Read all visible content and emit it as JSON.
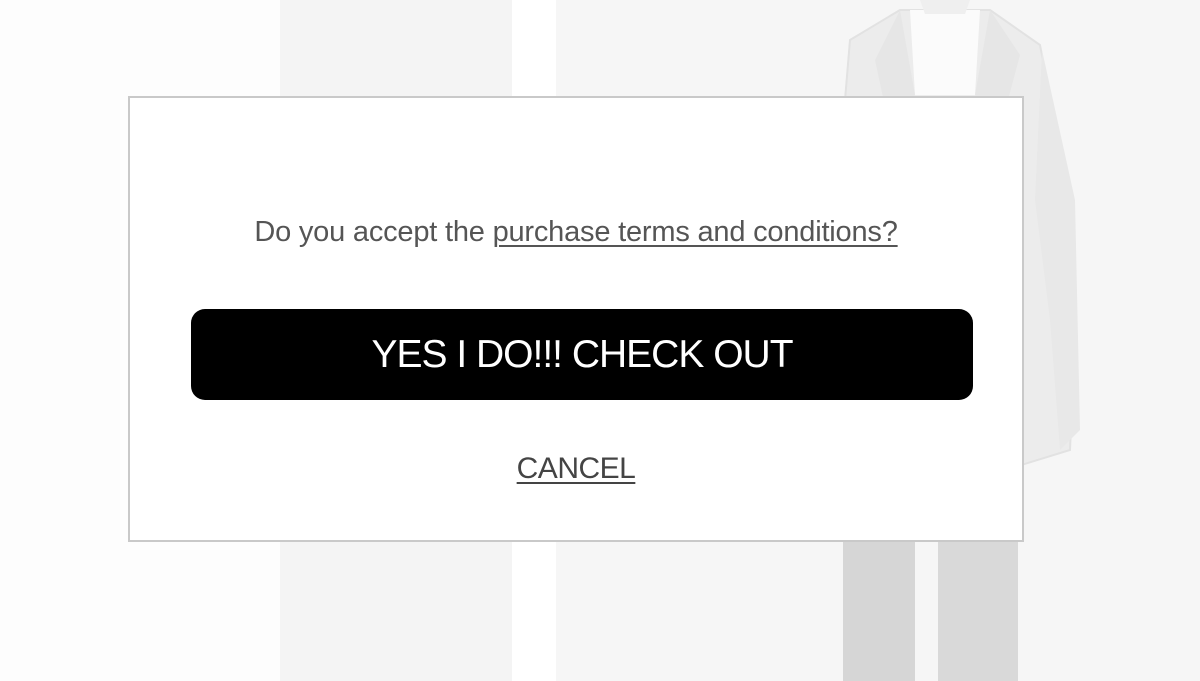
{
  "dialog": {
    "prompt_prefix": "Do you accept the ",
    "terms_link": "purchase terms and conditions?",
    "confirm_label": "YES I DO!!! CHECK OUT",
    "cancel_label": "CANCEL"
  },
  "colors": {
    "button_bg": "#000000",
    "button_text": "#ffffff",
    "text": "#555555",
    "modal_border": "#c9c9c9"
  }
}
